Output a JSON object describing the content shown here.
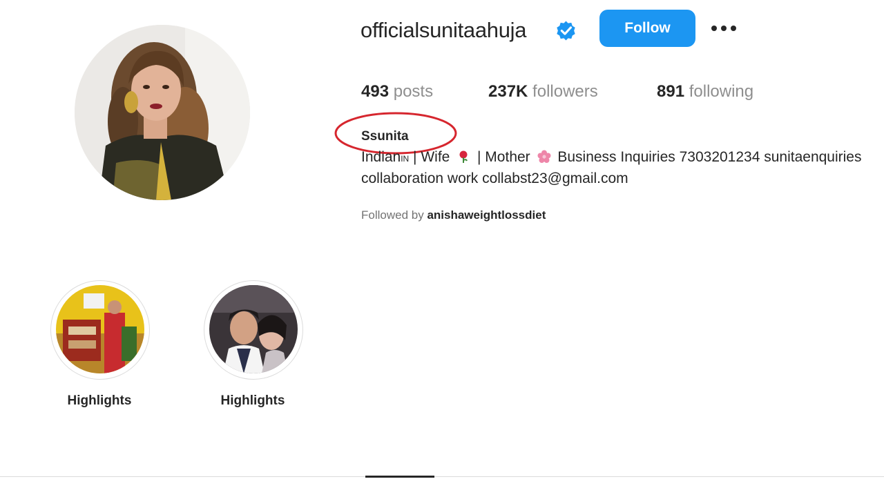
{
  "profile": {
    "username": "officialsunitaahuja",
    "follow_label": "Follow",
    "full_name": "Ssunita",
    "bio_line1_part1": "Indian",
    "bio_flag_code": "IN",
    "bio_line1_part2": " | Wife ",
    "bio_line1_part3": " | Mother ",
    "bio_line1_part4": " Business Inquiries 7303201234 sunitaenquiries",
    "bio_line2": "collaboration work collabst23@gmail.com",
    "followed_by_prefix": "Followed by ",
    "followed_by_user": "anishaweightlossdiet"
  },
  "stats": [
    {
      "count": "493",
      "label": "posts"
    },
    {
      "count": "237K",
      "label": "followers"
    },
    {
      "count": "891",
      "label": "following"
    }
  ],
  "highlights": [
    {
      "label": "Highlights"
    },
    {
      "label": "Highlights"
    }
  ],
  "colors": {
    "follow_button": "#1c96f2",
    "verified_badge": "#1c96f2",
    "annotation_circle": "#d6262e"
  },
  "icons": {
    "verified": "verified-badge-icon",
    "more": "more-options-icon",
    "rose": "rose-emoji-icon",
    "blossom": "cherry-blossom-emoji-icon"
  }
}
